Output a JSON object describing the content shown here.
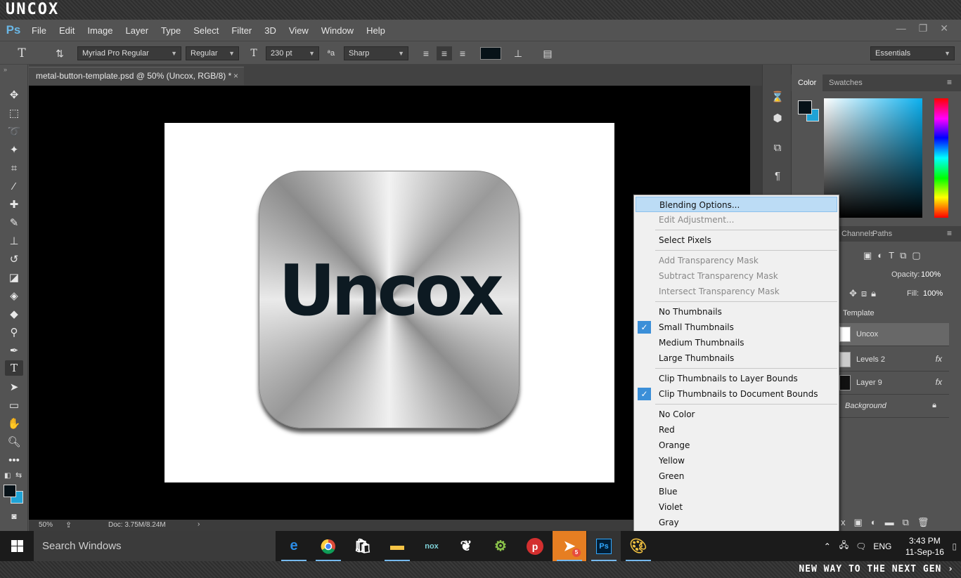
{
  "brand": {
    "logo": "UNCOX",
    "tagline": "NEW WAY TO THE NEXT GEN ›"
  },
  "app": {
    "logo": "Ps"
  },
  "menubar": {
    "items": [
      "File",
      "Edit",
      "Image",
      "Layer",
      "Type",
      "Select",
      "Filter",
      "3D",
      "View",
      "Window",
      "Help"
    ],
    "window_controls": [
      "—",
      "❐",
      "✕"
    ]
  },
  "options": {
    "tool_icon": "T",
    "font_family": "Myriad Pro Regular",
    "font_style": "Regular",
    "font_size": "230 pt",
    "antialias": "Sharp",
    "text_color": "#071218",
    "workspace": "Essentials"
  },
  "document": {
    "tab_title": "metal-button-template.psd @ 50% (Uncox, RGB/8) *",
    "tab_close": "×",
    "canvas_text": "Uncox",
    "zoom": "50%",
    "doc_info": "Doc: 3.75M/8.24M"
  },
  "color_panel": {
    "tabs": [
      "Color",
      "Swatches"
    ],
    "fg_color": "#071218",
    "bg_color": "#1fa3d6"
  },
  "layers_panel": {
    "tabs": [
      "Channels",
      "Paths"
    ],
    "opacity_label": "Opacity:",
    "opacity_value": "100%",
    "fill_label": "Fill:",
    "fill_value": "100%",
    "group_name": "Template",
    "layers": [
      {
        "name": "Uncox",
        "fx": ""
      },
      {
        "name": "Levels 2",
        "fx": "fx"
      },
      {
        "name": "Layer 9",
        "fx": "fx"
      },
      {
        "name": "Background",
        "fx": ""
      }
    ]
  },
  "context_menu": {
    "items": [
      {
        "label": "Blending Options...",
        "state": "highlight"
      },
      {
        "label": "Edit Adjustment...",
        "state": "disabled"
      },
      {
        "label": "Select Pixels",
        "state": "normal"
      },
      {
        "label": "Add Transparency Mask",
        "state": "disabled"
      },
      {
        "label": "Subtract Transparency Mask",
        "state": "disabled"
      },
      {
        "label": "Intersect Transparency Mask",
        "state": "disabled"
      },
      {
        "label": "No Thumbnails",
        "state": "normal"
      },
      {
        "label": "Small Thumbnails",
        "state": "checked"
      },
      {
        "label": "Medium Thumbnails",
        "state": "normal"
      },
      {
        "label": "Large Thumbnails",
        "state": "normal"
      },
      {
        "label": "Clip Thumbnails to Layer Bounds",
        "state": "normal"
      },
      {
        "label": "Clip Thumbnails to Document Bounds",
        "state": "checked"
      },
      {
        "label": "No Color",
        "state": "normal"
      },
      {
        "label": "Red",
        "state": "normal"
      },
      {
        "label": "Orange",
        "state": "normal"
      },
      {
        "label": "Yellow",
        "state": "normal"
      },
      {
        "label": "Green",
        "state": "normal"
      },
      {
        "label": "Blue",
        "state": "normal"
      },
      {
        "label": "Violet",
        "state": "normal"
      },
      {
        "label": "Gray",
        "state": "normal"
      }
    ]
  },
  "taskbar": {
    "search_placeholder": "Search Windows",
    "language": "ENG",
    "time": "3:43 PM",
    "date": "11-Sep-16",
    "telegram_badge": "5"
  }
}
